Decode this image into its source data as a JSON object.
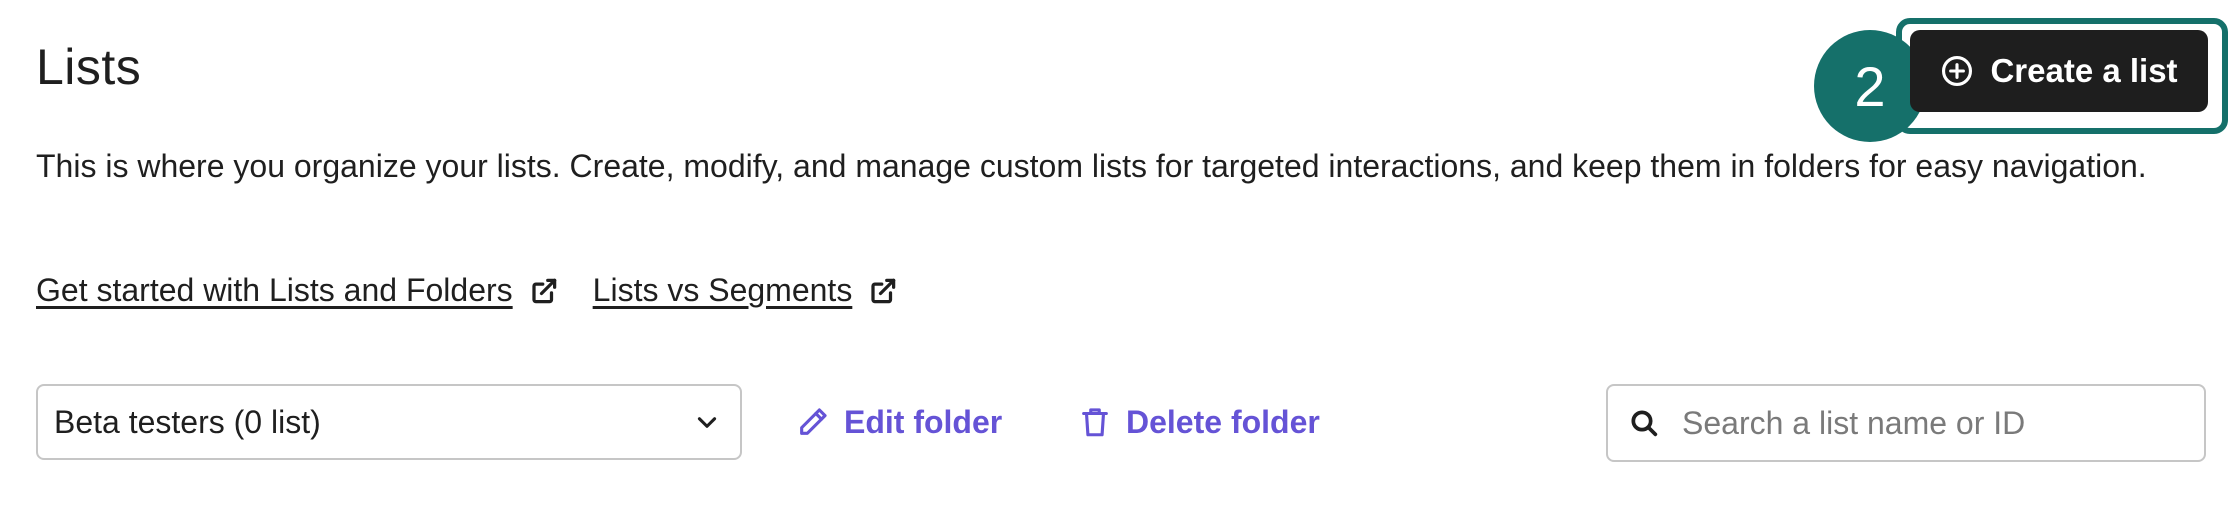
{
  "page": {
    "title": "Lists",
    "description": "This is where you organize your lists. Create, modify, and manage custom lists for targeted interactions, and keep them in folders for easy navigation."
  },
  "step_badge": {
    "number": "2",
    "color": "#15706a"
  },
  "create_button": {
    "label": "Create a list",
    "icon": "plus-circle-icon"
  },
  "help_links": [
    {
      "label": "Get started with Lists and Folders",
      "icon": "external-link-icon"
    },
    {
      "label": "Lists vs Segments",
      "icon": "external-link-icon"
    }
  ],
  "folder_select": {
    "value": "Beta testers (0 list)",
    "icon": "chevron-down-icon"
  },
  "actions": {
    "edit_folder": {
      "label": "Edit folder",
      "icon": "pencil-icon"
    },
    "delete_folder": {
      "label": "Delete folder",
      "icon": "trash-icon"
    }
  },
  "search": {
    "placeholder": "Search a list name or ID",
    "value": "",
    "icon": "search-icon"
  },
  "colors": {
    "accent": "#6553d6",
    "highlight": "#15706a",
    "primary_button": "#1e1e1e"
  }
}
